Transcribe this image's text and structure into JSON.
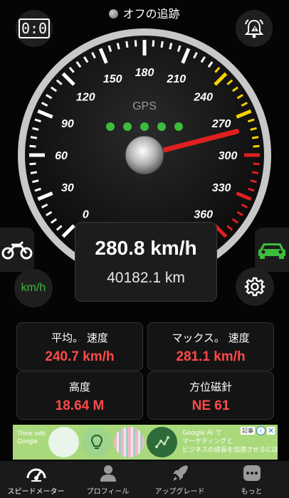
{
  "status": {
    "tracking_label": "オフの追跡"
  },
  "top_left": {
    "timer": "0:0"
  },
  "gauge": {
    "ticks": [
      "0",
      "30",
      "60",
      "90",
      "120",
      "150",
      "180",
      "210",
      "240",
      "270",
      "300",
      "330",
      "360"
    ],
    "max": 360,
    "needle_value": 280.8,
    "gps_label": "GPS",
    "gps_dots": 5
  },
  "readout": {
    "speed": "280.8 km/h",
    "distance": "40182.1 km"
  },
  "unit_button": {
    "label": "km/h"
  },
  "stats": [
    {
      "label": "平均。 速度",
      "value": "240.7 km/h"
    },
    {
      "label": "マックス。 速度",
      "value": "281.1 km/h"
    },
    {
      "label": "高度",
      "value": "18.64 M"
    },
    {
      "label": "方位磁針",
      "value": "NE 61"
    }
  ],
  "ad": {
    "logo_text": "Think with Google",
    "title": "Google AI で",
    "body_line1": "マーケティングと",
    "body_line2": "ビジネスの成長を加速させるには?",
    "badge": "記事"
  },
  "nav": [
    {
      "label": "スピードメーター",
      "icon": "speedometer-icon"
    },
    {
      "label": "プロフィール",
      "icon": "person-icon"
    },
    {
      "label": "アップグレード",
      "icon": "rocket-icon"
    },
    {
      "label": "もっと",
      "icon": "more-icon"
    }
  ],
  "colors": {
    "accent_green": "#3dbb3d",
    "value_red": "#ff4a4a",
    "needle": "#e02020",
    "warn_yellow": "#f4d300"
  }
}
